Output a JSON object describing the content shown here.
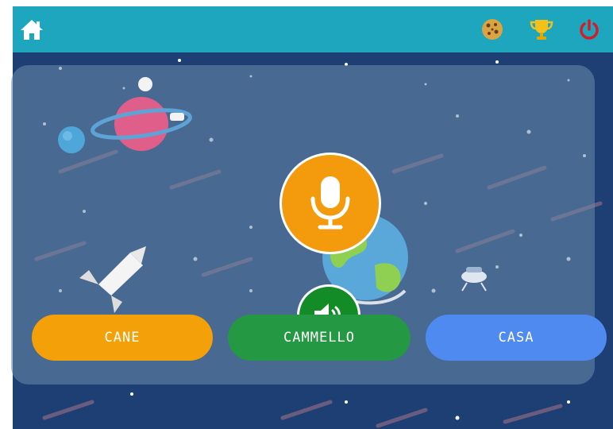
{
  "topbar": {
    "home_icon": "home-icon",
    "cookie_icon": "cookie-icon",
    "trophy_icon": "trophy-icon",
    "power_icon": "power-icon"
  },
  "colors": {
    "topbar": "#1ea6bf",
    "mic": "#f39a0d",
    "speaker": "#138c28",
    "power": "#d21e2a"
  },
  "controls": {
    "mic_icon": "microphone-icon",
    "speaker_icon": "speaker-icon"
  },
  "answers": [
    {
      "label": "CANE",
      "color": "#f4a009"
    },
    {
      "label": "CAMMELLO",
      "color": "#259843"
    },
    {
      "label": "CASA",
      "color": "#4f8af1"
    }
  ]
}
